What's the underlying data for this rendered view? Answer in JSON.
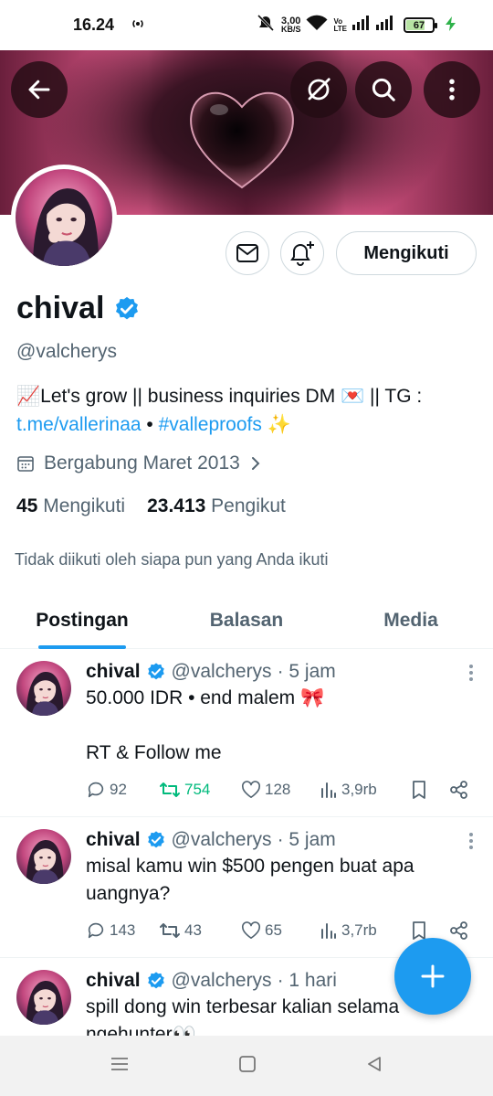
{
  "status_bar": {
    "time": "16.24",
    "net_speed_value": "3,00",
    "net_speed_unit": "KB/S",
    "volte_line1": "Vo",
    "volte_line2": "LTE",
    "battery": "67"
  },
  "banner": {
    "back_icon": "back-arrow-icon",
    "grok_icon": "grok-icon",
    "search_icon": "search-icon",
    "more_icon": "more-vertical-icon"
  },
  "profile": {
    "display_name": "chival",
    "handle": "@valcherys",
    "bio_line1": "📈Let's grow || business inquiries DM 💌 || TG :",
    "bio_link1": "t.me/vallerinaa",
    "bio_sep": " • ",
    "bio_link2": "#valleproofs",
    "bio_emoji": " ✨",
    "joined": "Bergabung Maret 2013",
    "following_count": "45",
    "following_label": "Mengikuti",
    "followers_count": "23.413",
    "followers_label": "Pengikut",
    "not_followed_text": "Tidak diikuti oleh siapa pun yang Anda ikuti",
    "follow_button": "Mengikuti",
    "verified_color": "#1d9bf0"
  },
  "tabs": [
    {
      "label": "Postingan",
      "active": true
    },
    {
      "label": "Balasan",
      "active": false
    },
    {
      "label": "Media",
      "active": false
    }
  ],
  "tweets": [
    {
      "name": "chival",
      "handle": "@valcherys",
      "time": "· 5 jam",
      "text": "50.000 IDR • end malem 🎀\n\nRT & Follow me",
      "replies": "92",
      "retweets": "754",
      "likes": "128",
      "views": "3,9rb",
      "retweeted": true
    },
    {
      "name": "chival",
      "handle": "@valcherys",
      "time": "· 5 jam",
      "text": "misal kamu win $500 pengen buat apa uangnya?",
      "replies": "143",
      "retweets": "43",
      "likes": "65",
      "views": "3,7rb",
      "retweeted": false
    },
    {
      "name": "chival",
      "handle": "@valcherys",
      "time": "· 1 hari",
      "text": "spill dong win terbesar kalian selama ngehunter👀"
    }
  ],
  "colors": {
    "accent": "#1d9bf0",
    "retweet_green": "#00ba7c",
    "secondary_text": "#536471"
  }
}
